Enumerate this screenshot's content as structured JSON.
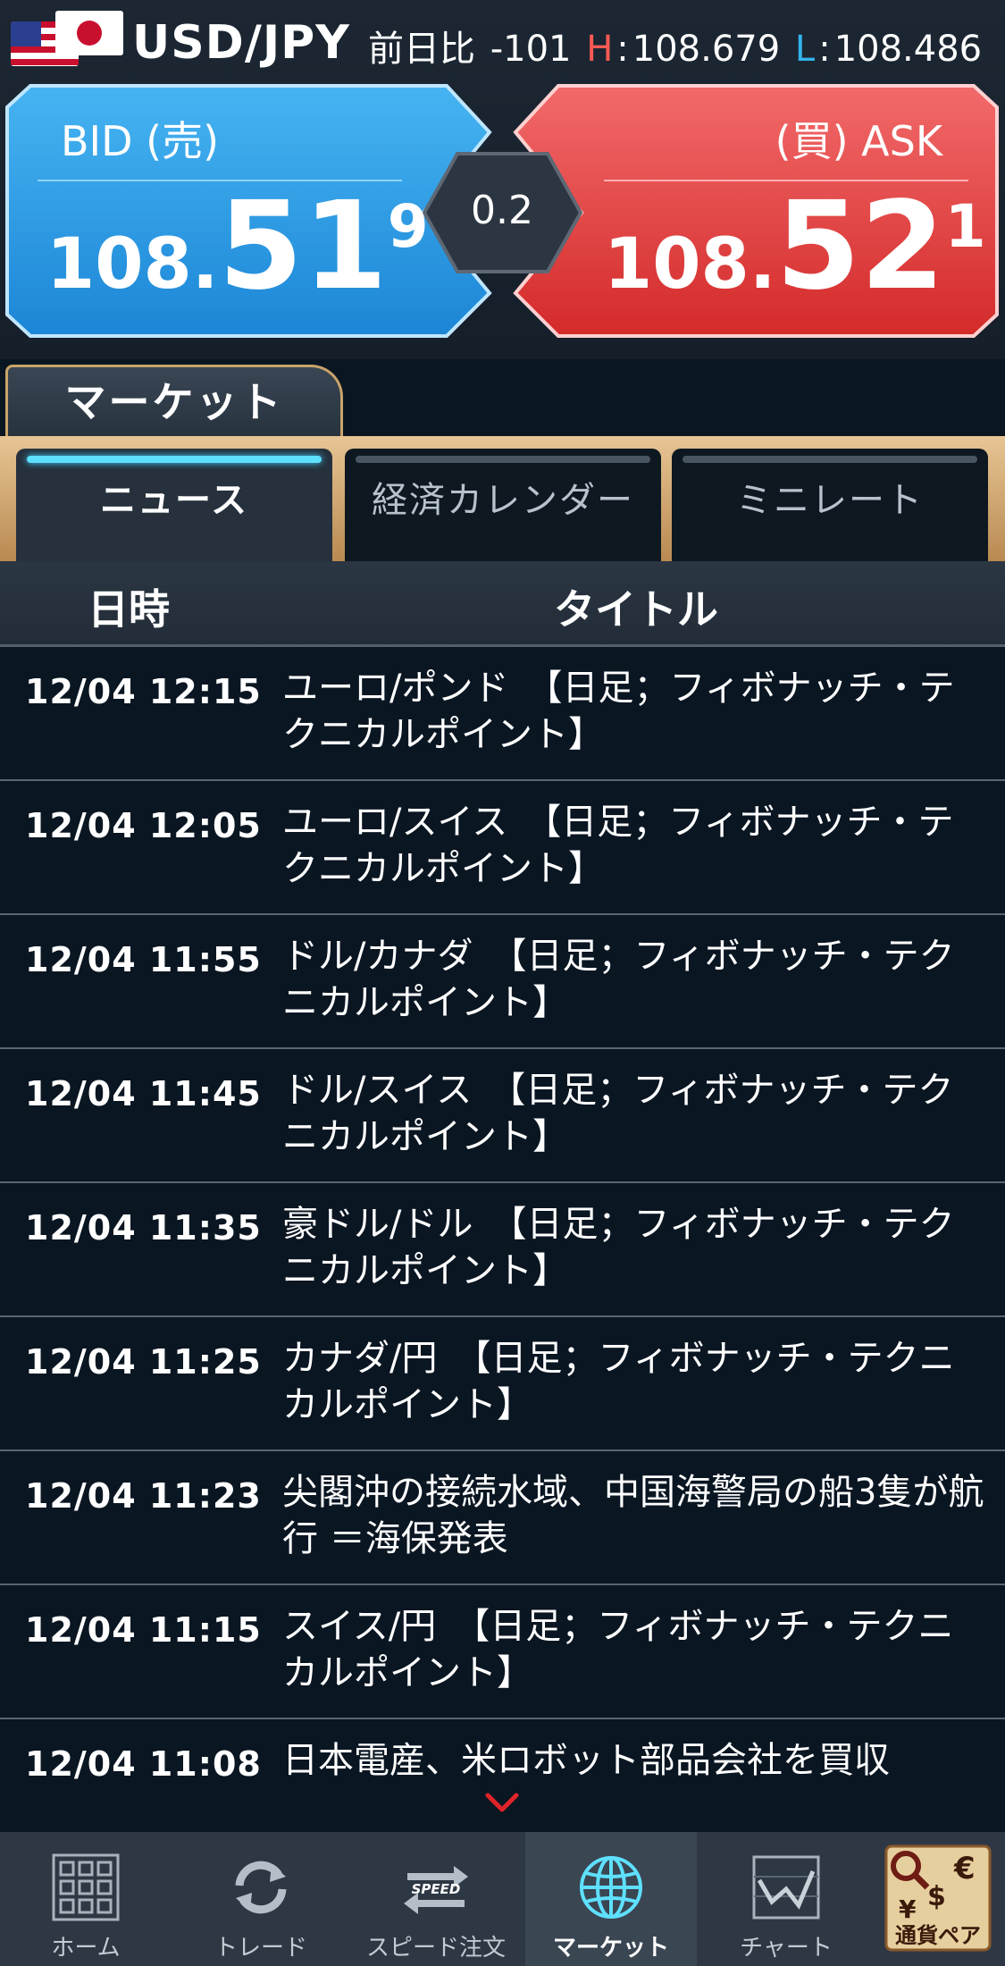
{
  "header": {
    "pair": "USD/JPY",
    "change_label": "前日比",
    "change_value": "-101",
    "high_label": "H",
    "high_value": "108.679",
    "low_label": "L",
    "low_value": "108.486"
  },
  "quote": {
    "bid_label": "BID (売)",
    "bid_a": "108.",
    "bid_b": "51",
    "bid_c": "9",
    "ask_label": "(買) ASK",
    "ask_a": "108.",
    "ask_b": "52",
    "ask_c": "1",
    "spread": "0.2"
  },
  "market_tab": "マーケット",
  "sub_tabs": [
    "ニュース",
    "経済カレンダー",
    "ミニレート"
  ],
  "table": {
    "col_date": "日時",
    "col_title": "タイトル"
  },
  "news": [
    {
      "time": "12/04 12:15",
      "title": "ユーロ/ポンド　【日足；フィボナッチ・テクニカルポイント】"
    },
    {
      "time": "12/04 12:05",
      "title": "ユーロ/スイス　【日足；フィボナッチ・テクニカルポイント】"
    },
    {
      "time": "12/04 11:55",
      "title": "ドル/カナダ　【日足；フィボナッチ・テクニカルポイント】"
    },
    {
      "time": "12/04 11:45",
      "title": "ドル/スイス　【日足；フィボナッチ・テクニカルポイント】"
    },
    {
      "time": "12/04 11:35",
      "title": "豪ドル/ドル　【日足；フィボナッチ・テクニカルポイント】"
    },
    {
      "time": "12/04 11:25",
      "title": "カナダ/円　【日足；フィボナッチ・テクニカルポイント】"
    },
    {
      "time": "12/04 11:23",
      "title": "尖閣沖の接続水域、中国海警局の船3隻が航行 ＝海保発表"
    },
    {
      "time": "12/04 11:15",
      "title": "スイス/円　【日足；フィボナッチ・テクニカルポイント】"
    },
    {
      "time": "12/04 11:08",
      "title": "日本電産、米ロボット部品会社を買収"
    }
  ],
  "nav": [
    {
      "label": "ホーム",
      "icon": "grid-icon"
    },
    {
      "label": "トレード",
      "icon": "refresh-icon"
    },
    {
      "label": "スピード注文",
      "icon": "speed-icon"
    },
    {
      "label": "マーケット",
      "icon": "globe-icon"
    },
    {
      "label": "チャート",
      "icon": "chart-icon"
    },
    {
      "label": "通貨ペア",
      "icon": "currency-pair-icon"
    }
  ],
  "nav_speed_text": "SPEED",
  "colors": {
    "bid": "#2f9fe3",
    "ask": "#e33b3b",
    "accent_tab": "#5ee0ff",
    "gold": "#c9a46a"
  }
}
